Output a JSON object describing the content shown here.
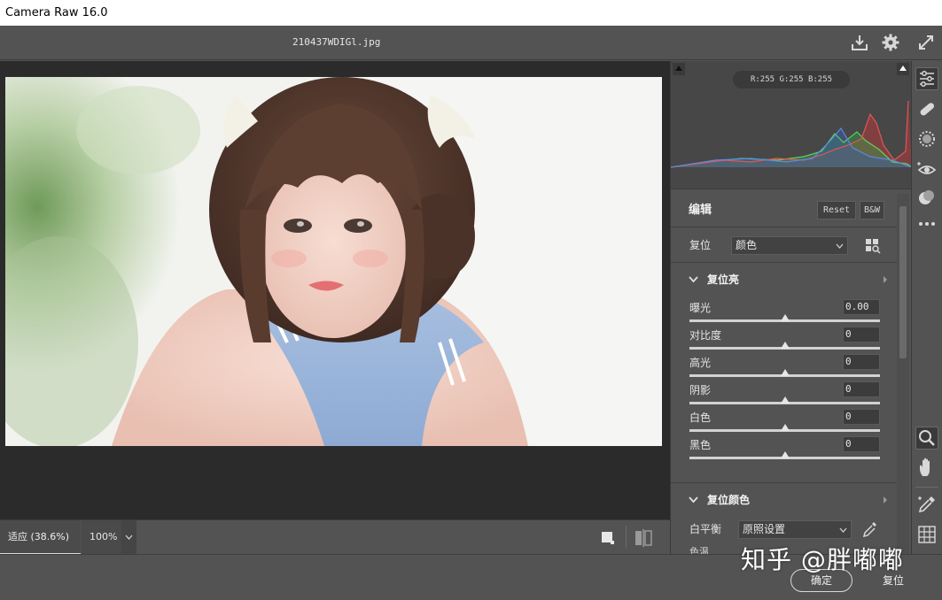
{
  "window": {
    "title": "Camera Raw 16.0"
  },
  "topbar": {
    "filename": "210437WDIGl.jpg"
  },
  "icons": {
    "save": "download-icon",
    "settings": "gear-icon",
    "fullscreen": "expand-icon"
  },
  "histogram": {
    "readout": "R:255  G:255  B:255"
  },
  "edit": {
    "title": "编辑",
    "reset_button": "Reset",
    "bw_button": "B&W",
    "profile_label": "复位",
    "profile_value": "颜色"
  },
  "light_section": {
    "title": "复位亮",
    "sliders": [
      {
        "label": "曝光",
        "value": "0.00"
      },
      {
        "label": "对比度",
        "value": "0"
      },
      {
        "label": "高光",
        "value": "0"
      },
      {
        "label": "阴影",
        "value": "0"
      },
      {
        "label": "白色",
        "value": "0"
      },
      {
        "label": "黑色",
        "value": "0"
      }
    ]
  },
  "color_section": {
    "title": "复位颜色",
    "wb_label": "白平衡",
    "wb_value": "原照设置",
    "temp_label": "色温"
  },
  "statusbar": {
    "fit_label": "适应 (38.6%)",
    "zoom_label": "100%"
  },
  "footer": {
    "ok_button": "确定",
    "reset_button": "复位"
  },
  "watermark": "知乎 @胖嘟嘟",
  "colors": {
    "accent": "#dcdcdc",
    "panel_bg": "#535353",
    "canvas_bg": "#2b2b2b"
  }
}
